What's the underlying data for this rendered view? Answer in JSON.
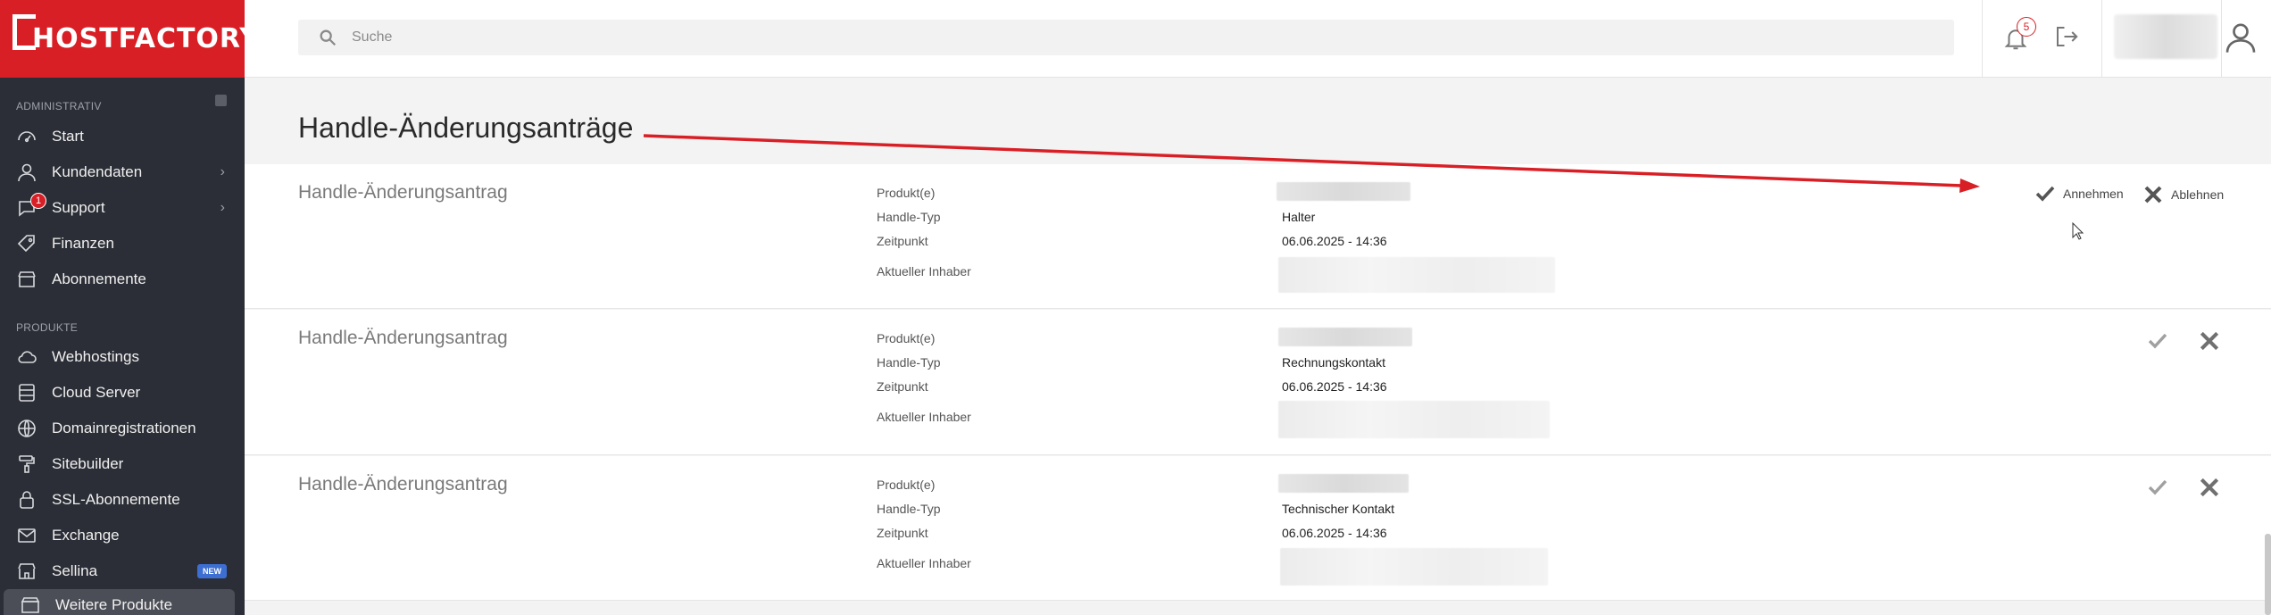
{
  "brand": {
    "name": "HOSTFACTORY",
    "accent": "#d91f26"
  },
  "sidebar": {
    "section_admin": "ADMINISTRATIV",
    "section_products": "PRODUKTE",
    "items": [
      {
        "label": "Start",
        "icon": "gauge-icon"
      },
      {
        "label": "Kundendaten",
        "icon": "user-icon",
        "has_submenu": true
      },
      {
        "label": "Support",
        "icon": "chat-icon",
        "has_submenu": true,
        "badge": "1"
      },
      {
        "label": "Finanzen",
        "icon": "tag-icon"
      },
      {
        "label": "Abonnemente",
        "icon": "store-icon"
      }
    ],
    "product_items": [
      {
        "label": "Webhostings",
        "icon": "cloud-icon"
      },
      {
        "label": "Cloud Server",
        "icon": "server-icon"
      },
      {
        "label": "Domainregistrationen",
        "icon": "globe-icon"
      },
      {
        "label": "Sitebuilder",
        "icon": "paint-roller-icon"
      },
      {
        "label": "SSL-Abonnemente",
        "icon": "lock-icon"
      },
      {
        "label": "Exchange",
        "icon": "mail-icon"
      },
      {
        "label": "Sellina",
        "icon": "shop-icon",
        "badge": "NEW"
      },
      {
        "label": "Weitere Produkte",
        "icon": "box-icon"
      }
    ]
  },
  "topbar": {
    "search_placeholder": "Suche",
    "notifications_count": "5"
  },
  "page": {
    "title": "Handle-Änderungsanträge"
  },
  "labels": {
    "products": "Produkt(e)",
    "handle_type": "Handle-Typ",
    "time": "Zeitpunkt",
    "current_owner": "Aktueller Inhaber",
    "accept": "Annehmen",
    "reject": "Ablehnen"
  },
  "requests": [
    {
      "title": "Handle-Änderungsantrag",
      "handle_type": "Halter",
      "time": "06.06.2025 - 14:36"
    },
    {
      "title": "Handle-Änderungsantrag",
      "handle_type": "Rechnungskontakt",
      "time": "06.06.2025 - 14:36"
    },
    {
      "title": "Handle-Änderungsantrag",
      "handle_type": "Technischer Kontakt",
      "time": "06.06.2025 - 14:36"
    }
  ]
}
